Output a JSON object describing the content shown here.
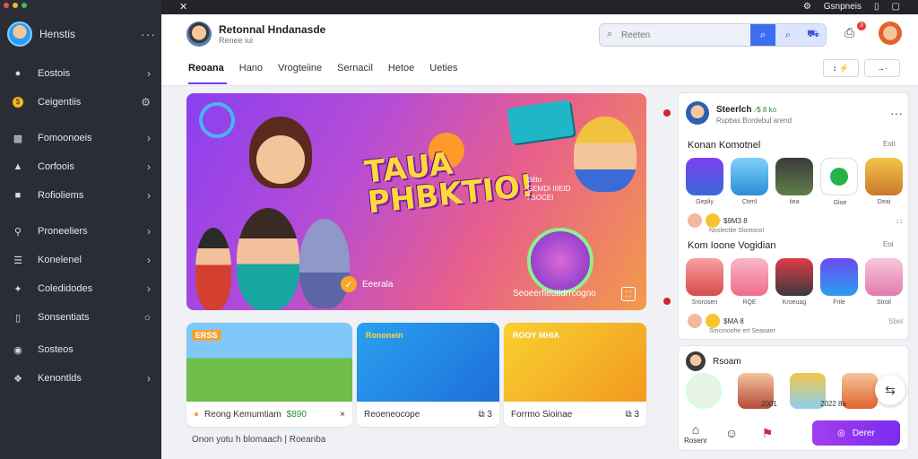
{
  "colors": {
    "sidebar_bg": "#2b2d36",
    "accent": "#6a3df0",
    "search_btn": "#3d6ef0",
    "cta": "#8b2ff0"
  },
  "sidebar": {
    "user_name": "Henstis",
    "more": "···",
    "items": [
      {
        "label": "Eostois",
        "icon": "user-icon"
      },
      {
        "label": "Ceigentiis",
        "icon": "coin-icon"
      },
      {
        "label": "Fomoonoeis",
        "icon": "folder-icon"
      },
      {
        "label": "Corfoois",
        "icon": "bell-icon"
      },
      {
        "label": "Rofioliems",
        "icon": "file-icon"
      },
      {
        "label": "Proneeliers",
        "icon": "search-icon"
      },
      {
        "label": "Konelenel",
        "icon": "list-icon"
      },
      {
        "label": "Coledidodes",
        "icon": "tools-icon"
      },
      {
        "label": "Sonsentiats",
        "icon": "book-icon"
      },
      {
        "label": "Sosteos",
        "icon": "chat-icon"
      },
      {
        "label": "Kenontlds",
        "icon": "compass-icon"
      }
    ]
  },
  "topbar": {
    "right_label": "Gsnpneis"
  },
  "header": {
    "profile_title": "Retonnal Hndanasde",
    "profile_sub": "Renee iui",
    "search_placeholder": "Reeten",
    "notif_count": "3",
    "tabs": [
      "Reoana",
      "Hano",
      "Vrogteiine",
      "Sernacil",
      "Hetoe",
      "Ueties"
    ],
    "btn1": "↕ ⚡",
    "btn2": "→·"
  },
  "hero": {
    "title_line1": "TAUA",
    "title_line2": "PHBKTIO!",
    "cta": "Eeerala",
    "subtitle": "Seoeerfleutidrrcogno",
    "side_text": "Bitto\nGEMDI IIIEID\nI SOCEI"
  },
  "cards": [
    {
      "tag": "ERSS",
      "caption": "Reong Kemumtiam",
      "price": "$890",
      "extra": "×"
    },
    {
      "tag": "Rononein",
      "caption": "Reoeneocope",
      "extra": "⧉ 3"
    },
    {
      "tag": "ROOY MHIA",
      "caption": "Forrmo Sioinae",
      "extra": "⧉ 3"
    }
  ],
  "footer_note": "Onon yotu h blomaach | Roeanba",
  "right_panel": {
    "user": "Steerlch",
    "user_badge": "⁄$ 8 ko",
    "user_sub": "Rspbas Bordebul arend",
    "section1": "Konan Komotnel",
    "section1_key": "Eoit",
    "row1_labels": [
      "Gepliy",
      "Ctenl",
      "Iiea",
      "Gloe",
      "Deai"
    ],
    "meta1": "$9M3 8",
    "meta1_sub": "Noslectile Slontonsl",
    "meta1_end": "↕↕",
    "section2": "Kom Ioone Vogidian",
    "section2_key": "Eoi",
    "row2_labels": [
      "Srorosen",
      "RQE",
      "Kroeuag",
      "Frile",
      "Stroil"
    ],
    "meta2": "$MA 8",
    "meta2_sub": "Smcmoohe ert Seaoaer",
    "meta2_end": "Sbel"
  },
  "right_panel2": {
    "title": "Rsoam",
    "labels": [
      "2001",
      "2022 8a"
    ]
  },
  "bottom_bar": {
    "home": "Rosenr",
    "main_btn": "Derer"
  }
}
